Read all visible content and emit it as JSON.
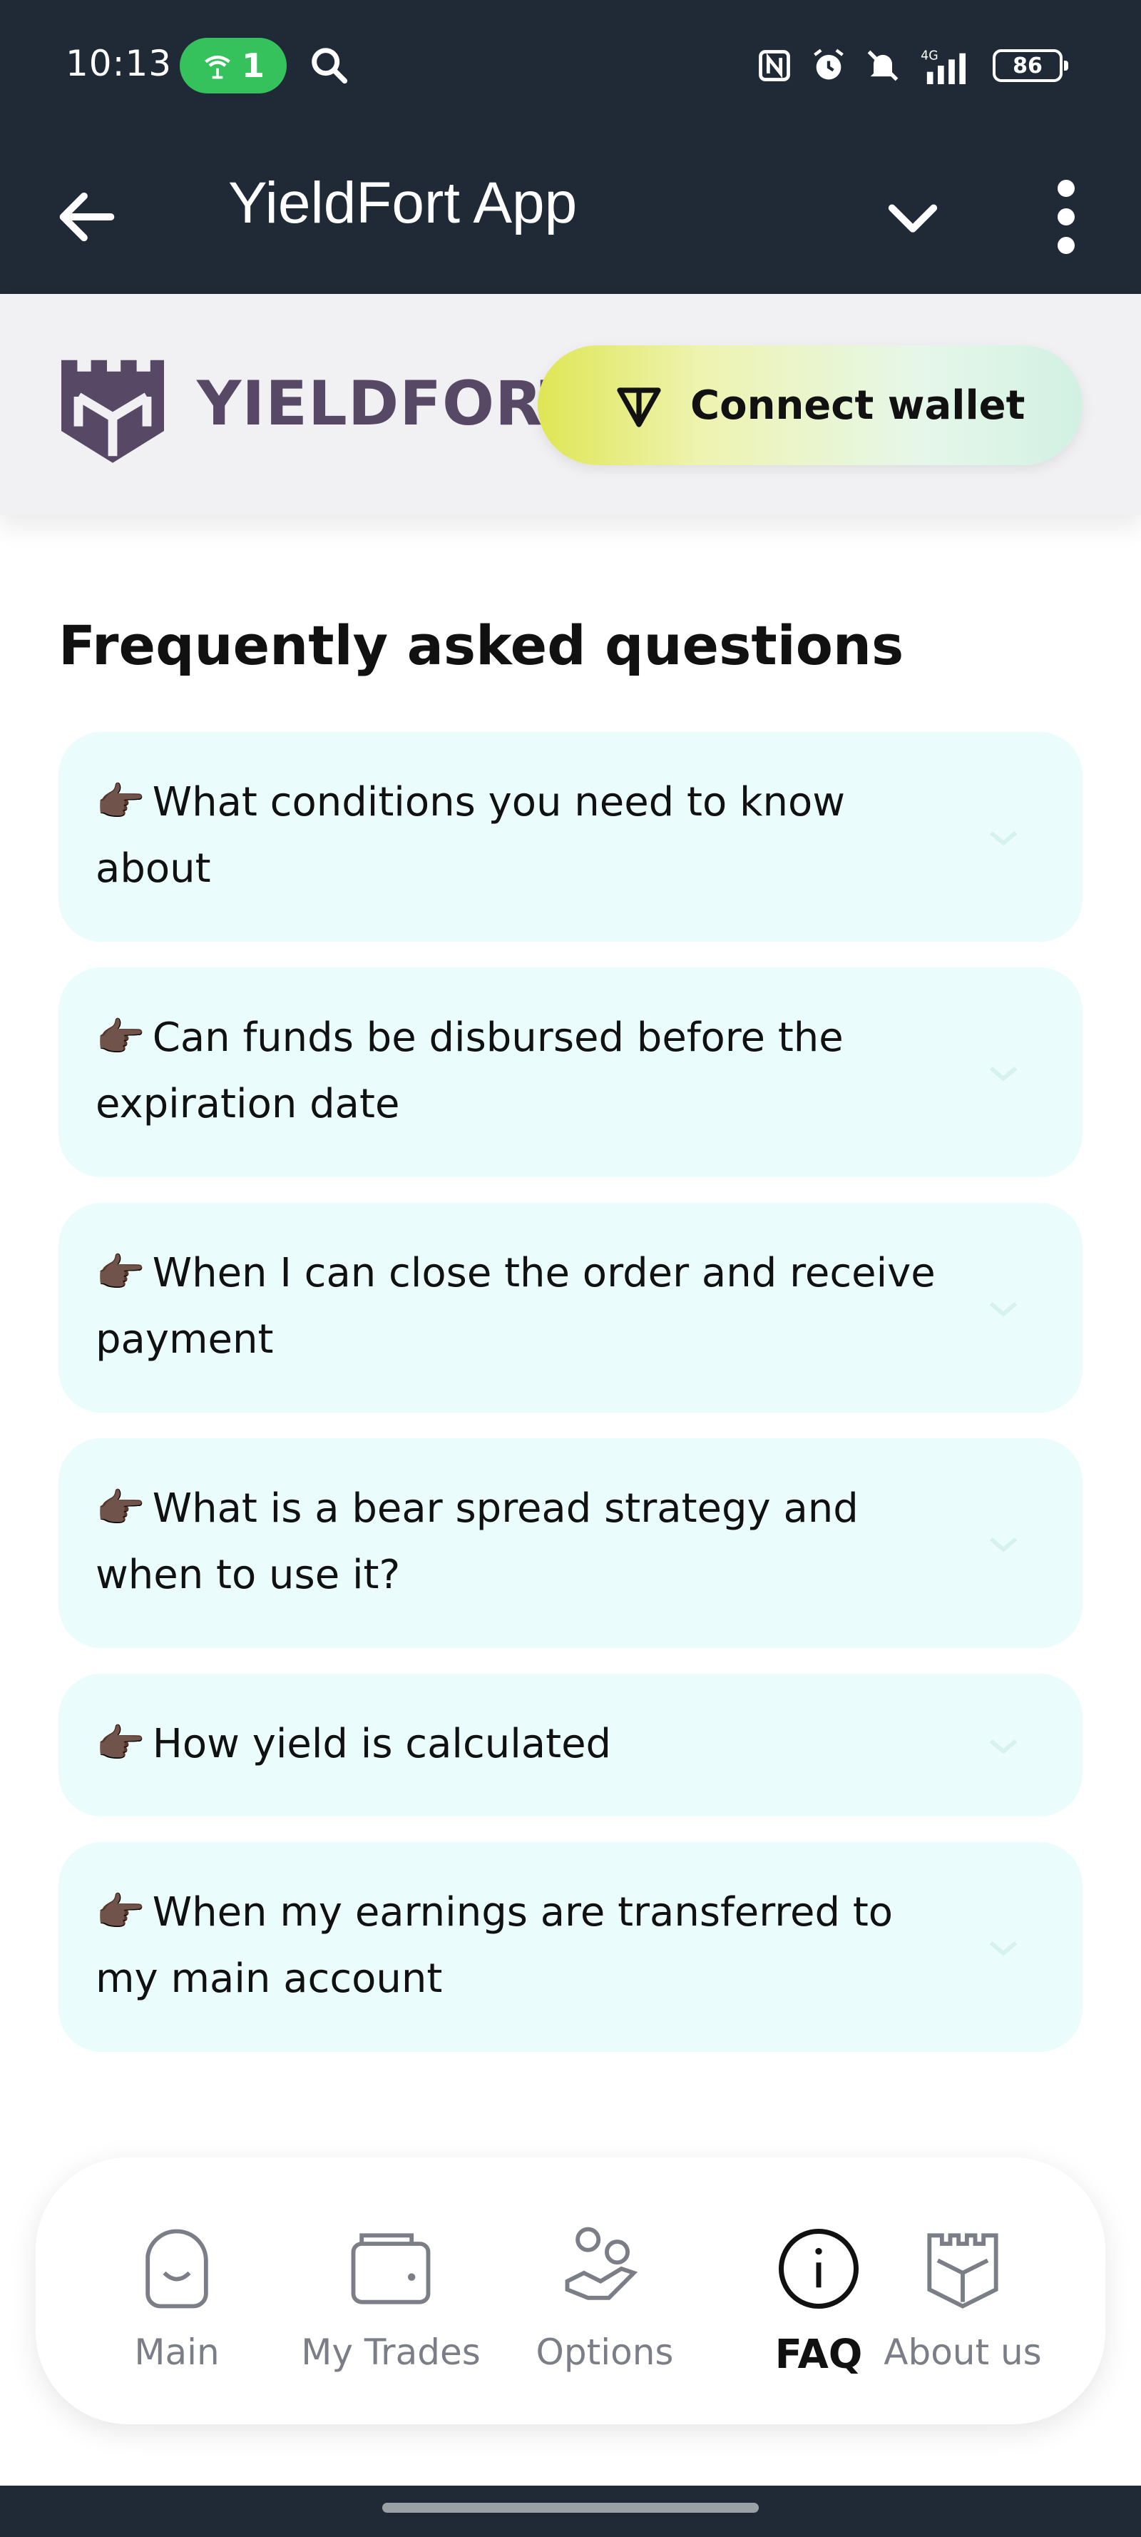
{
  "status_bar": {
    "time": "10:13",
    "hotspot_count": "1",
    "network": "4G",
    "battery": "86"
  },
  "app_bar": {
    "title": "YieldFort App"
  },
  "brand": {
    "name": "YIELDFORT",
    "color": "#574865"
  },
  "connect_wallet": {
    "label": "Connect wallet"
  },
  "faq": {
    "title": "Frequently asked questions",
    "items": [
      {
        "question": "What conditions you need to know about"
      },
      {
        "question": "Can funds be disbursed before the expiration date"
      },
      {
        "question": "When I can close the order and receive payment"
      },
      {
        "question": "What is a bear spread strategy and when to use it?"
      },
      {
        "question": "How yield is calculated"
      },
      {
        "question": "When my earnings are transferred to my main account"
      }
    ],
    "item_background": "#eafdfc",
    "bullet_icon": "pointing-hand-icon"
  },
  "bottom_nav": {
    "items": [
      {
        "label": "Main",
        "icon": "smile-bubble-icon",
        "active": false
      },
      {
        "label": "My Trades",
        "icon": "wallet-icon",
        "active": false
      },
      {
        "label": "Options",
        "icon": "hand-coins-icon",
        "active": false
      },
      {
        "label": "FAQ",
        "icon": "info-circle-icon",
        "active": true
      },
      {
        "label": "About us",
        "icon": "fortress-icon",
        "active": false
      }
    ]
  },
  "colors": {
    "topbar": "#1f2a36",
    "hotspot": "#35c25d",
    "header_band": "#f1f1f3"
  }
}
